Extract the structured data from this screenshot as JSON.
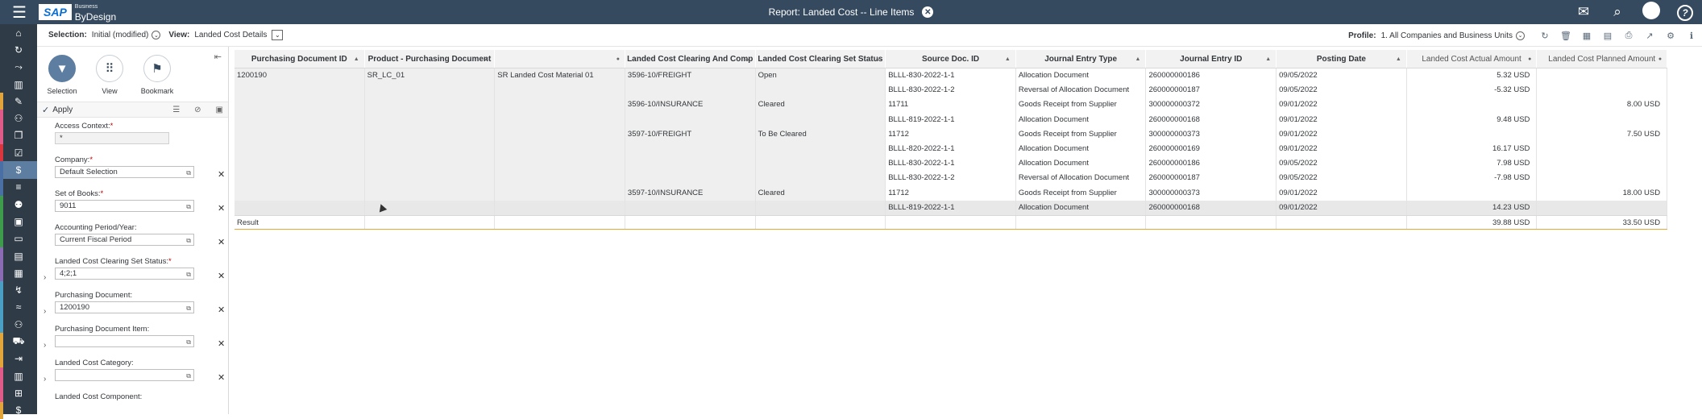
{
  "topbar": {
    "logo_brand": "SAP",
    "logo_sub": "Business",
    "logo_product": "ByDesign",
    "title": "Report: Landed Cost -- Line Items",
    "close_icon": "close-circle-icon",
    "right_icons": [
      "notifications-icon",
      "search-icon",
      "user-avatar-icon",
      "help-icon"
    ]
  },
  "nav_rail": {
    "items": [
      {
        "icon": "home-icon",
        "stripe": ""
      },
      {
        "icon": "refresh-icon",
        "stripe": ""
      },
      {
        "icon": "route-icon",
        "stripe": ""
      },
      {
        "icon": "chart-icon",
        "stripe": ""
      },
      {
        "icon": "edit-icon",
        "stripe": "#e2a53b"
      },
      {
        "icon": "group-icon",
        "stripe": "#e05a8a"
      },
      {
        "icon": "documents-icon",
        "stripe": "#e05a8a"
      },
      {
        "icon": "checklist-icon",
        "stripe": "#d9363e"
      },
      {
        "icon": "money-icon",
        "stripe": "#4a6fa5"
      },
      {
        "icon": "list-icon",
        "stripe": "#4a6fa5"
      },
      {
        "icon": "people-cost-icon",
        "stripe": "#3d9b4b"
      },
      {
        "icon": "box-icon",
        "stripe": "#3d9b4b"
      },
      {
        "icon": "folder-icon",
        "stripe": "#3d9b4b"
      },
      {
        "icon": "document-icon",
        "stripe": "#8a6bb4"
      },
      {
        "icon": "calendar-icon",
        "stripe": "#8a6bb4"
      },
      {
        "icon": "trend-icon",
        "stripe": "#4a9fc4"
      },
      {
        "icon": "waves-icon",
        "stripe": "#4a9fc4"
      },
      {
        "icon": "people-icon",
        "stripe": "#4a9fc4"
      },
      {
        "icon": "vehicle-icon",
        "stripe": "#e2a53b"
      },
      {
        "icon": "export-icon",
        "stripe": "#e2a53b"
      },
      {
        "icon": "building-icon",
        "stripe": "#e05a8a"
      },
      {
        "icon": "hierarchy-icon",
        "stripe": "#e05a8a"
      },
      {
        "icon": "dollar-icon",
        "stripe": "#e2a53b"
      }
    ],
    "active_index": 8
  },
  "selection_bar": {
    "selection_label": "Selection:",
    "selection_value": "Initial (modified)",
    "view_label": "View:",
    "view_value": "Landed Cost Details",
    "profile_label": "Profile:",
    "profile_value": "1. All Companies and Business Units",
    "toolbar_icons": [
      "refresh-icon",
      "delete-icon",
      "table-icon",
      "table-settings-icon",
      "print-icon",
      "export-icon",
      "settings-icon",
      "info-icon"
    ]
  },
  "left_panel": {
    "buttons": [
      {
        "label": "Selection",
        "icon": "funnel-icon"
      },
      {
        "label": "View",
        "icon": "grid-dots-icon"
      },
      {
        "label": "Bookmark",
        "icon": "bookmark-icon"
      }
    ],
    "apply_label": "Apply",
    "fields": [
      {
        "label": "Access Context:",
        "required": true,
        "value": "*",
        "disabled": true,
        "expand": false
      },
      {
        "label": "Company:",
        "required": true,
        "value": "Default Selection",
        "disabled": false,
        "expand": false
      },
      {
        "label": "Set of Books:",
        "required": true,
        "value": "9011",
        "disabled": false,
        "expand": false
      },
      {
        "label": "Accounting Period/Year:",
        "required": false,
        "value": "Current Fiscal Period",
        "disabled": false,
        "expand": false
      },
      {
        "label": "Landed Cost Clearing Set Status:",
        "required": true,
        "value": "4;2;1",
        "disabled": false,
        "expand": true
      },
      {
        "label": "Purchasing Document:",
        "required": false,
        "value": "1200190",
        "disabled": false,
        "expand": true
      },
      {
        "label": "Purchasing Document Item:",
        "required": false,
        "value": "",
        "disabled": false,
        "expand": true
      },
      {
        "label": "Landed Cost Category:",
        "required": false,
        "value": "",
        "disabled": false,
        "expand": true
      },
      {
        "label": "Landed Cost Component:",
        "required": false,
        "value": null,
        "disabled": false,
        "expand": false
      }
    ]
  },
  "table": {
    "columns": [
      "Purchasing Document ID",
      "Product - Purchasing Document",
      "",
      "Landed Cost Clearing And Comp",
      "Landed Cost Clearing Set Status",
      "Source Doc. ID",
      "Journal Entry Type",
      "Journal Entry ID",
      "Posting Date",
      "Landed Cost Actual Amount",
      "Landed Cost Planned Amount"
    ],
    "rows": [
      [
        "1200190",
        "SR_LC_01",
        "SR Landed Cost Material 01",
        "3596-10/FREIGHT",
        "Open",
        "BLLL-830-2022-1-1",
        "Allocation Document",
        "260000000186",
        "09/05/2022",
        "5.32 USD",
        ""
      ],
      [
        "",
        "",
        "",
        "",
        "",
        "BLLL-830-2022-1-2",
        "Reversal of Allocation Document",
        "260000000187",
        "09/05/2022",
        "-5.32 USD",
        ""
      ],
      [
        "",
        "",
        "",
        "3596-10/INSURANCE",
        "Cleared",
        "11711",
        "Goods Receipt from Supplier",
        "300000000372",
        "09/01/2022",
        "",
        "8.00 USD"
      ],
      [
        "",
        "",
        "",
        "",
        "",
        "BLLL-819-2022-1-1",
        "Allocation Document",
        "260000000168",
        "09/01/2022",
        "9.48 USD",
        ""
      ],
      [
        "",
        "",
        "",
        "3597-10/FREIGHT",
        "To Be Cleared",
        "11712",
        "Goods Receipt from Supplier",
        "300000000373",
        "09/01/2022",
        "",
        "7.50 USD"
      ],
      [
        "",
        "",
        "",
        "",
        "",
        "BLLL-820-2022-1-1",
        "Allocation Document",
        "260000000169",
        "09/01/2022",
        "16.17 USD",
        ""
      ],
      [
        "",
        "",
        "",
        "",
        "",
        "BLLL-830-2022-1-1",
        "Allocation Document",
        "260000000186",
        "09/05/2022",
        "7.98 USD",
        ""
      ],
      [
        "",
        "",
        "",
        "",
        "",
        "BLLL-830-2022-1-2",
        "Reversal of Allocation Document",
        "260000000187",
        "09/05/2022",
        "-7.98 USD",
        ""
      ],
      [
        "",
        "",
        "",
        "3597-10/INSURANCE",
        "Cleared",
        "11712",
        "Goods Receipt from Supplier",
        "300000000373",
        "09/01/2022",
        "",
        "18.00 USD"
      ],
      [
        "",
        "",
        "",
        "",
        "",
        "BLLL-819-2022-1-1",
        "Allocation Document",
        "260000000168",
        "09/01/2022",
        "14.23 USD",
        ""
      ]
    ],
    "result_label": "Result",
    "result_actual": "39.88 USD",
    "result_planned": "33.50 USD"
  }
}
